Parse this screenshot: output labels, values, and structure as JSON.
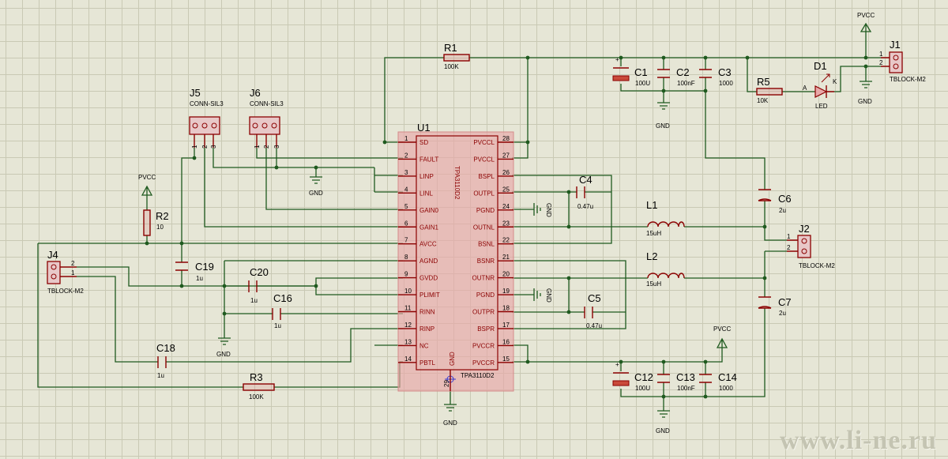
{
  "watermark": "www.li-ne.ru",
  "ic": {
    "designator": "U1",
    "part": "TPA3110D2",
    "left_pins": [
      {
        "num": "1",
        "name": "SD"
      },
      {
        "num": "2",
        "name": "FAULT"
      },
      {
        "num": "3",
        "name": "LINP"
      },
      {
        "num": "4",
        "name": "LINL"
      },
      {
        "num": "5",
        "name": "GAIN0"
      },
      {
        "num": "6",
        "name": "GAIN1"
      },
      {
        "num": "7",
        "name": "AVCC"
      },
      {
        "num": "8",
        "name": "AGND"
      },
      {
        "num": "9",
        "name": "GVDD"
      },
      {
        "num": "10",
        "name": "PLIMIT"
      },
      {
        "num": "11",
        "name": "RINN"
      },
      {
        "num": "12",
        "name": "RINP"
      },
      {
        "num": "13",
        "name": "NC"
      },
      {
        "num": "14",
        "name": "PBTL"
      }
    ],
    "right_pins": [
      {
        "num": "28",
        "name": "PVCCL"
      },
      {
        "num": "27",
        "name": "PVCCL"
      },
      {
        "num": "26",
        "name": "BSPL"
      },
      {
        "num": "25",
        "name": "OUTPL"
      },
      {
        "num": "24",
        "name": "PGND"
      },
      {
        "num": "23",
        "name": "OUTNL"
      },
      {
        "num": "22",
        "name": "BSNL"
      },
      {
        "num": "21",
        "name": "BSNR"
      },
      {
        "num": "20",
        "name": "OUTNR"
      },
      {
        "num": "19",
        "name": "PGND"
      },
      {
        "num": "18",
        "name": "OUTPR"
      },
      {
        "num": "17",
        "name": "BSPR"
      },
      {
        "num": "16",
        "name": "PVCCR"
      },
      {
        "num": "15",
        "name": "PVCCR"
      }
    ],
    "gnd_pin": {
      "num": "29",
      "name": "GND"
    }
  },
  "components": {
    "R1": {
      "ref": "R1",
      "value": "100K"
    },
    "R2": {
      "ref": "R2",
      "value": "10"
    },
    "R3": {
      "ref": "R3",
      "value": "100K"
    },
    "R5": {
      "ref": "R5",
      "value": "10K"
    },
    "C1": {
      "ref": "C1",
      "value": "100U"
    },
    "C2": {
      "ref": "C2",
      "value": "100nF"
    },
    "C3": {
      "ref": "C3",
      "value": "1000"
    },
    "C4": {
      "ref": "C4",
      "value": "0.47u"
    },
    "C5": {
      "ref": "C5",
      "value": "0.47u"
    },
    "C6": {
      "ref": "C6",
      "value": "2u"
    },
    "C7": {
      "ref": "C7",
      "value": "2u"
    },
    "C12": {
      "ref": "C12",
      "value": "100U"
    },
    "C13": {
      "ref": "C13",
      "value": "100nF"
    },
    "C14": {
      "ref": "C14",
      "value": "1000"
    },
    "C16": {
      "ref": "C16",
      "value": "1u"
    },
    "C18": {
      "ref": "C18",
      "value": "1u"
    },
    "C19": {
      "ref": "C19",
      "value": "1u"
    },
    "C20": {
      "ref": "C20",
      "value": "1u"
    },
    "L1": {
      "ref": "L1",
      "value": "15uH"
    },
    "L2": {
      "ref": "L2",
      "value": "15uH"
    },
    "D1": {
      "ref": "D1",
      "value": "LED",
      "anode": "A",
      "cathode": "K"
    },
    "J1": {
      "ref": "J1",
      "value": "TBLOCK-M2",
      "pin1": "1",
      "pin2": "2"
    },
    "J2": {
      "ref": "J2",
      "value": "TBLOCK-M2",
      "pin1": "1",
      "pin2": "2"
    },
    "J4": {
      "ref": "J4",
      "value": "TBLOCK-M2",
      "pin1": "1",
      "pin2": "2"
    },
    "J5": {
      "ref": "J5",
      "value": "CONN-SIL3",
      "pin1": "1",
      "pin2": "2",
      "pin3": "3"
    },
    "J6": {
      "ref": "J6",
      "value": "CONN-SIL3",
      "pin1": "1",
      "pin2": "2",
      "pin3": "3"
    }
  },
  "power": {
    "pvcc_label": "PVCC",
    "gnd_label": "GND"
  }
}
